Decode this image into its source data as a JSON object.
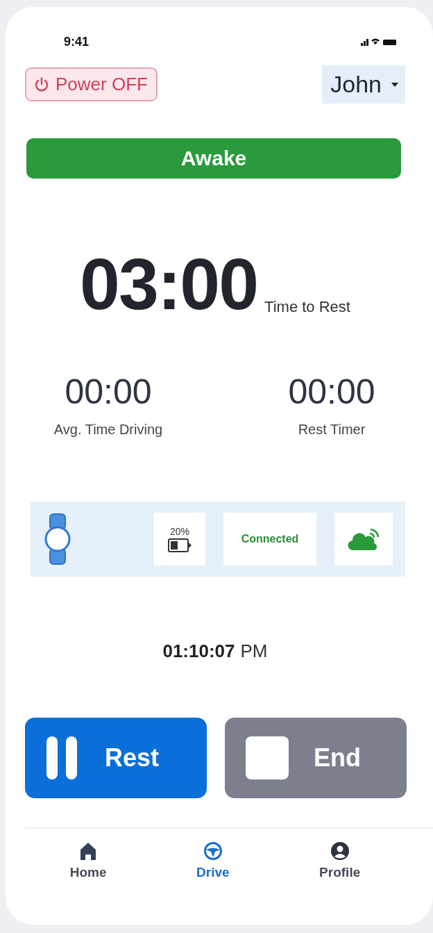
{
  "status_bar": {
    "time": "9:41"
  },
  "header": {
    "power_button": "Power OFF",
    "user": "John"
  },
  "status_banner": {
    "label": "Awake",
    "kind": "awake"
  },
  "main_timer": {
    "value": "03:00",
    "label": "Time to Rest"
  },
  "timers": [
    {
      "value": "00:00",
      "label": "Avg. Time Driving"
    },
    {
      "value": "00:00",
      "label": "Rest Timer"
    }
  ],
  "device": {
    "battery": "20%",
    "connection": "Connected"
  },
  "clock": {
    "time": "01:10:07",
    "period": "PM"
  },
  "actions": [
    {
      "label": "Rest",
      "kind": "rest"
    },
    {
      "label": "End",
      "kind": "end"
    }
  ],
  "tabs": [
    {
      "label": "Home",
      "kind": "home",
      "selected": false
    },
    {
      "label": "Drive",
      "kind": "drive",
      "selected": true
    },
    {
      "label": "Profile",
      "kind": "profile",
      "selected": false
    }
  ]
}
